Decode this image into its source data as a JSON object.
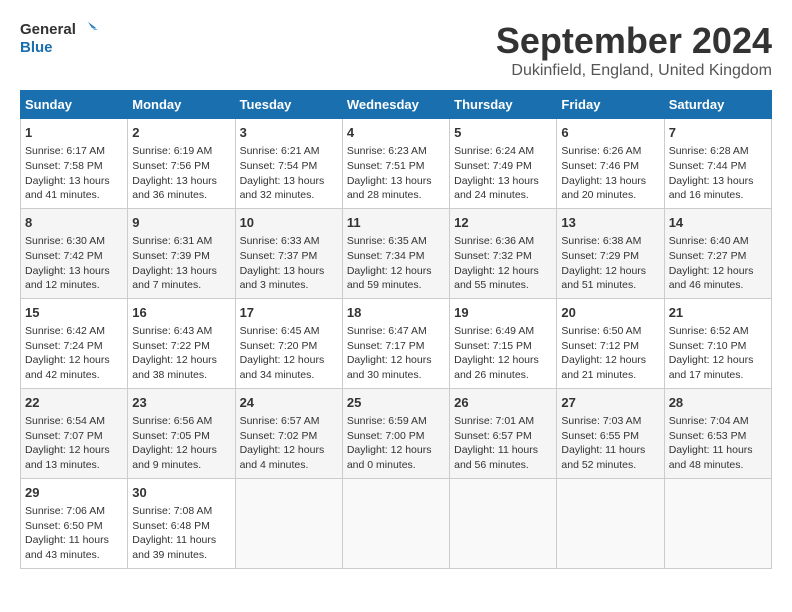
{
  "logo": {
    "line1": "General",
    "line2": "Blue"
  },
  "title": "September 2024",
  "subtitle": "Dukinfield, England, United Kingdom",
  "headers": [
    "Sunday",
    "Monday",
    "Tuesday",
    "Wednesday",
    "Thursday",
    "Friday",
    "Saturday"
  ],
  "weeks": [
    [
      {
        "day": "1",
        "info": "Sunrise: 6:17 AM\nSunset: 7:58 PM\nDaylight: 13 hours\nand 41 minutes."
      },
      {
        "day": "2",
        "info": "Sunrise: 6:19 AM\nSunset: 7:56 PM\nDaylight: 13 hours\nand 36 minutes."
      },
      {
        "day": "3",
        "info": "Sunrise: 6:21 AM\nSunset: 7:54 PM\nDaylight: 13 hours\nand 32 minutes."
      },
      {
        "day": "4",
        "info": "Sunrise: 6:23 AM\nSunset: 7:51 PM\nDaylight: 13 hours\nand 28 minutes."
      },
      {
        "day": "5",
        "info": "Sunrise: 6:24 AM\nSunset: 7:49 PM\nDaylight: 13 hours\nand 24 minutes."
      },
      {
        "day": "6",
        "info": "Sunrise: 6:26 AM\nSunset: 7:46 PM\nDaylight: 13 hours\nand 20 minutes."
      },
      {
        "day": "7",
        "info": "Sunrise: 6:28 AM\nSunset: 7:44 PM\nDaylight: 13 hours\nand 16 minutes."
      }
    ],
    [
      {
        "day": "8",
        "info": "Sunrise: 6:30 AM\nSunset: 7:42 PM\nDaylight: 13 hours\nand 12 minutes."
      },
      {
        "day": "9",
        "info": "Sunrise: 6:31 AM\nSunset: 7:39 PM\nDaylight: 13 hours\nand 7 minutes."
      },
      {
        "day": "10",
        "info": "Sunrise: 6:33 AM\nSunset: 7:37 PM\nDaylight: 13 hours\nand 3 minutes."
      },
      {
        "day": "11",
        "info": "Sunrise: 6:35 AM\nSunset: 7:34 PM\nDaylight: 12 hours\nand 59 minutes."
      },
      {
        "day": "12",
        "info": "Sunrise: 6:36 AM\nSunset: 7:32 PM\nDaylight: 12 hours\nand 55 minutes."
      },
      {
        "day": "13",
        "info": "Sunrise: 6:38 AM\nSunset: 7:29 PM\nDaylight: 12 hours\nand 51 minutes."
      },
      {
        "day": "14",
        "info": "Sunrise: 6:40 AM\nSunset: 7:27 PM\nDaylight: 12 hours\nand 46 minutes."
      }
    ],
    [
      {
        "day": "15",
        "info": "Sunrise: 6:42 AM\nSunset: 7:24 PM\nDaylight: 12 hours\nand 42 minutes."
      },
      {
        "day": "16",
        "info": "Sunrise: 6:43 AM\nSunset: 7:22 PM\nDaylight: 12 hours\nand 38 minutes."
      },
      {
        "day": "17",
        "info": "Sunrise: 6:45 AM\nSunset: 7:20 PM\nDaylight: 12 hours\nand 34 minutes."
      },
      {
        "day": "18",
        "info": "Sunrise: 6:47 AM\nSunset: 7:17 PM\nDaylight: 12 hours\nand 30 minutes."
      },
      {
        "day": "19",
        "info": "Sunrise: 6:49 AM\nSunset: 7:15 PM\nDaylight: 12 hours\nand 26 minutes."
      },
      {
        "day": "20",
        "info": "Sunrise: 6:50 AM\nSunset: 7:12 PM\nDaylight: 12 hours\nand 21 minutes."
      },
      {
        "day": "21",
        "info": "Sunrise: 6:52 AM\nSunset: 7:10 PM\nDaylight: 12 hours\nand 17 minutes."
      }
    ],
    [
      {
        "day": "22",
        "info": "Sunrise: 6:54 AM\nSunset: 7:07 PM\nDaylight: 12 hours\nand 13 minutes."
      },
      {
        "day": "23",
        "info": "Sunrise: 6:56 AM\nSunset: 7:05 PM\nDaylight: 12 hours\nand 9 minutes."
      },
      {
        "day": "24",
        "info": "Sunrise: 6:57 AM\nSunset: 7:02 PM\nDaylight: 12 hours\nand 4 minutes."
      },
      {
        "day": "25",
        "info": "Sunrise: 6:59 AM\nSunset: 7:00 PM\nDaylight: 12 hours\nand 0 minutes."
      },
      {
        "day": "26",
        "info": "Sunrise: 7:01 AM\nSunset: 6:57 PM\nDaylight: 11 hours\nand 56 minutes."
      },
      {
        "day": "27",
        "info": "Sunrise: 7:03 AM\nSunset: 6:55 PM\nDaylight: 11 hours\nand 52 minutes."
      },
      {
        "day": "28",
        "info": "Sunrise: 7:04 AM\nSunset: 6:53 PM\nDaylight: 11 hours\nand 48 minutes."
      }
    ],
    [
      {
        "day": "29",
        "info": "Sunrise: 7:06 AM\nSunset: 6:50 PM\nDaylight: 11 hours\nand 43 minutes."
      },
      {
        "day": "30",
        "info": "Sunrise: 7:08 AM\nSunset: 6:48 PM\nDaylight: 11 hours\nand 39 minutes."
      },
      {
        "day": "",
        "info": ""
      },
      {
        "day": "",
        "info": ""
      },
      {
        "day": "",
        "info": ""
      },
      {
        "day": "",
        "info": ""
      },
      {
        "day": "",
        "info": ""
      }
    ]
  ]
}
